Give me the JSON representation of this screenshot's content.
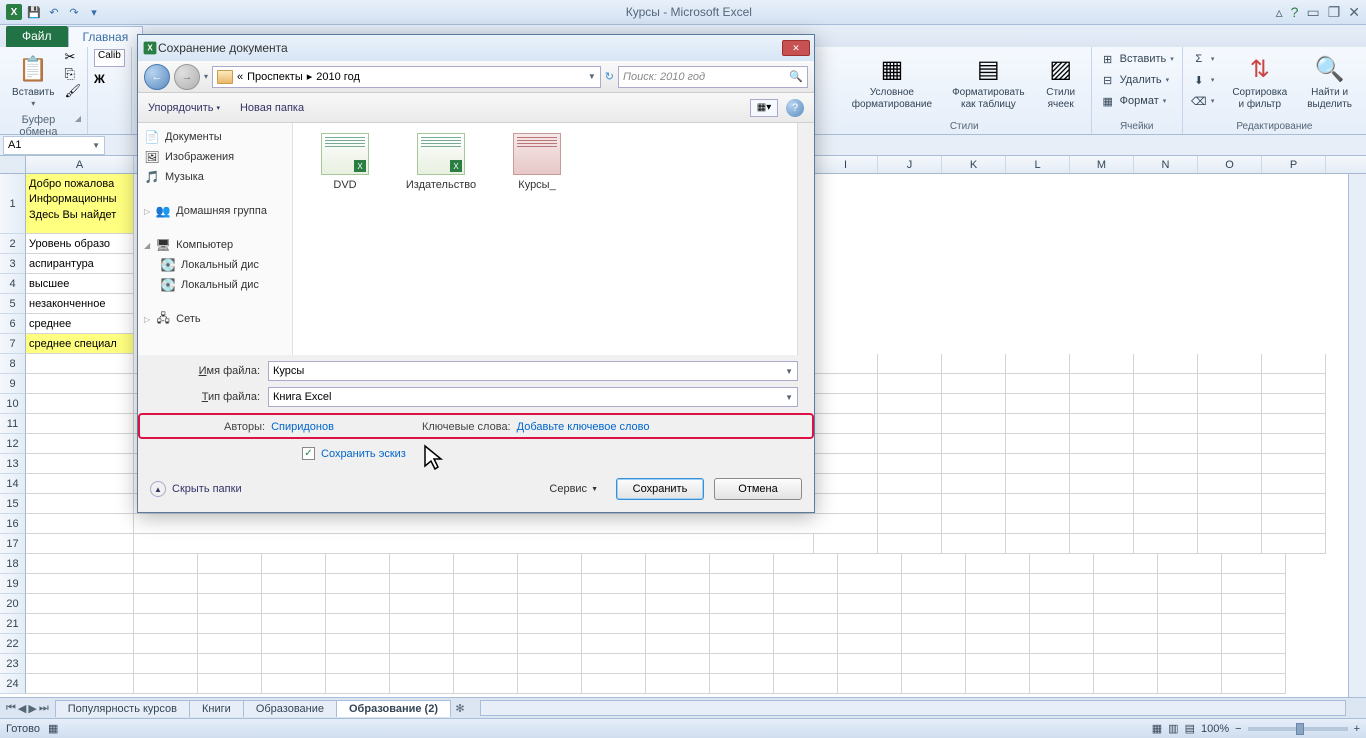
{
  "app_title": "Курсы - Microsoft Excel",
  "ribbon": {
    "file_tab": "Файл",
    "tabs": [
      "Главная"
    ],
    "groups": {
      "clipboard": {
        "label": "Буфер обмена",
        "paste": "Вставить"
      },
      "styles": {
        "label": "Стили",
        "cond": "Условное\nформатирование",
        "table": "Форматировать\nкак таблицу",
        "cell": "Стили\nячеек"
      },
      "cells": {
        "label": "Ячейки",
        "insert": "Вставить",
        "delete": "Удалить",
        "format": "Формат"
      },
      "editing": {
        "label": "Редактирование",
        "sort": "Сортировка\nи фильтр",
        "find": "Найти и\nвыделить"
      }
    },
    "font_family": "Calib"
  },
  "name_box": "A1",
  "columns": [
    "I",
    "J",
    "K",
    "L",
    "M",
    "N",
    "O",
    "P"
  ],
  "rows": {
    "merged": "Добро пожаловаИнформационныЗдесь Вы найдет",
    "l1": "Добро пожалова",
    "l2": "Информационны",
    "l3": "Здесь Вы найдет",
    "r2": "Уровень образо",
    "r3": "аспирантура",
    "r4": "высшее",
    "r5": "незаконченное",
    "r6": "среднее",
    "r7": "среднее специал"
  },
  "sheets": {
    "items": [
      "Популярность курсов",
      "Книги",
      "Образование",
      "Образование (2)"
    ],
    "active": 3
  },
  "status": {
    "ready": "Готово",
    "zoom": "100%"
  },
  "dialog": {
    "title": "Сохранение документа",
    "crumbs": {
      "sep": "«",
      "p1": "Проспекты",
      "p2": "2010 год"
    },
    "search_placeholder": "Поиск: 2010 год",
    "toolbar": {
      "organize": "Упорядочить",
      "new_folder": "Новая папка"
    },
    "tree": {
      "docs": "Документы",
      "images": "Изображения",
      "music": "Музыка",
      "homegroup": "Домашняя группа",
      "computer": "Компьютер",
      "disk1": "Локальный дис",
      "disk2": "Локальный дис",
      "network": "Сеть"
    },
    "files": [
      {
        "name": "DVD",
        "type": "xl"
      },
      {
        "name": "Издательство",
        "type": "xl"
      },
      {
        "name": "Курсы_",
        "type": "doc"
      }
    ],
    "filename_label": "Имя файла:",
    "filename": "Курсы",
    "filetype_label": "Тип файла:",
    "filetype": "Книга Excel",
    "authors_label": "Авторы:",
    "authors": "Спиридонов",
    "tags_label": "Ключевые слова:",
    "tags": "Добавьте ключевое слово",
    "thumbnail": "Сохранить эскиз",
    "hide_folders": "Скрыть папки",
    "service": "Сервис",
    "save": "Сохранить",
    "cancel": "Отмена"
  }
}
